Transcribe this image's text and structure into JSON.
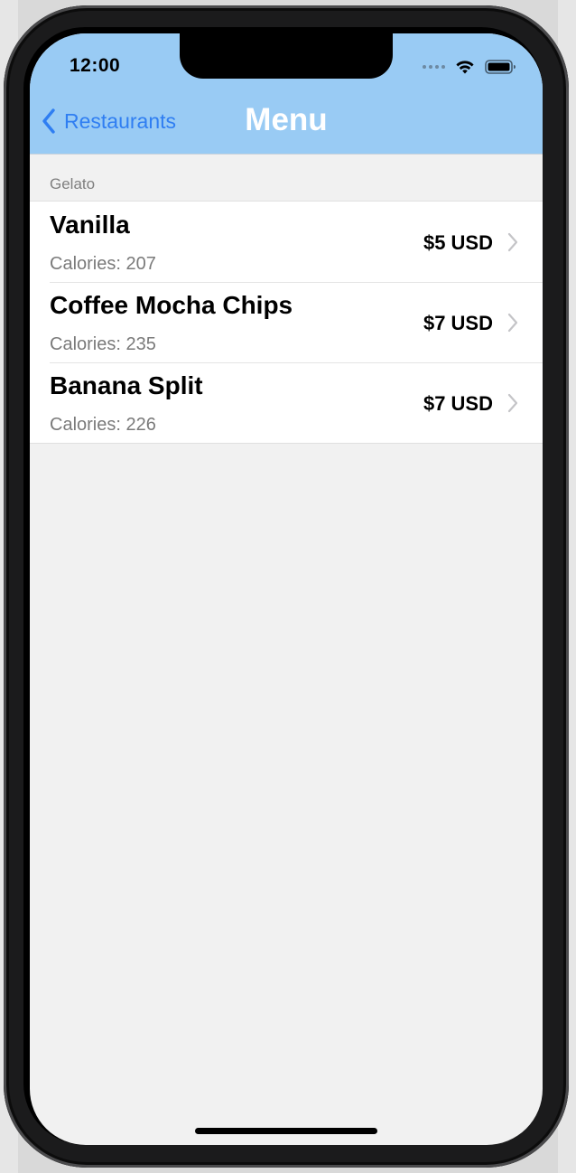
{
  "status_bar": {
    "time": "12:00"
  },
  "nav": {
    "back_label": "Restaurants",
    "title": "Menu",
    "background_color": "#99cbf4",
    "tint_color": "#2f7ef2"
  },
  "section": {
    "header": "Gelato"
  },
  "items": [
    {
      "name": "Vanilla",
      "calories": "Calories: 207",
      "price": "$5 USD"
    },
    {
      "name": "Coffee Mocha Chips",
      "calories": "Calories: 235",
      "price": "$7 USD"
    },
    {
      "name": "Banana Split",
      "calories": "Calories: 226",
      "price": "$7 USD"
    }
  ]
}
